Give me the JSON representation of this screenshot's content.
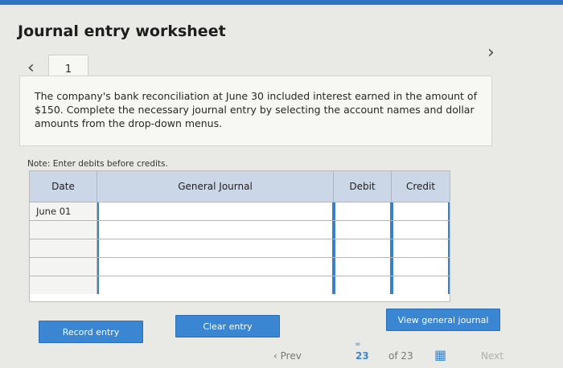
{
  "header": {
    "title": "Journal entry worksheet"
  },
  "nav": {
    "prev_icon": "chevron-left-icon",
    "next_icon": "chevron-right-icon",
    "step": "1"
  },
  "instructions": "The company's bank reconciliation at June 30 included interest earned in the amount of $150. Complete the necessary journal entry by selecting the account names and dollar amounts from the drop-down menus.",
  "note": "Note: Enter debits before credits.",
  "table": {
    "columns": [
      "Date",
      "General Journal",
      "Debit",
      "Credit"
    ],
    "rows": [
      {
        "date": "June 01",
        "account": "",
        "debit": "",
        "credit": ""
      },
      {
        "date": "",
        "account": "",
        "debit": "",
        "credit": ""
      },
      {
        "date": "",
        "account": "",
        "debit": "",
        "credit": ""
      },
      {
        "date": "",
        "account": "",
        "debit": "",
        "credit": ""
      },
      {
        "date": "",
        "account": "",
        "debit": "",
        "credit": ""
      }
    ]
  },
  "buttons": {
    "record": "Record entry",
    "clear": "Clear entry",
    "view": "View general journal"
  },
  "pager": {
    "prev": "Prev",
    "current": "23",
    "of": "of 23",
    "next": "Next"
  },
  "colors": {
    "accent": "#3b86d3",
    "header_bg": "#cbd6e6"
  }
}
